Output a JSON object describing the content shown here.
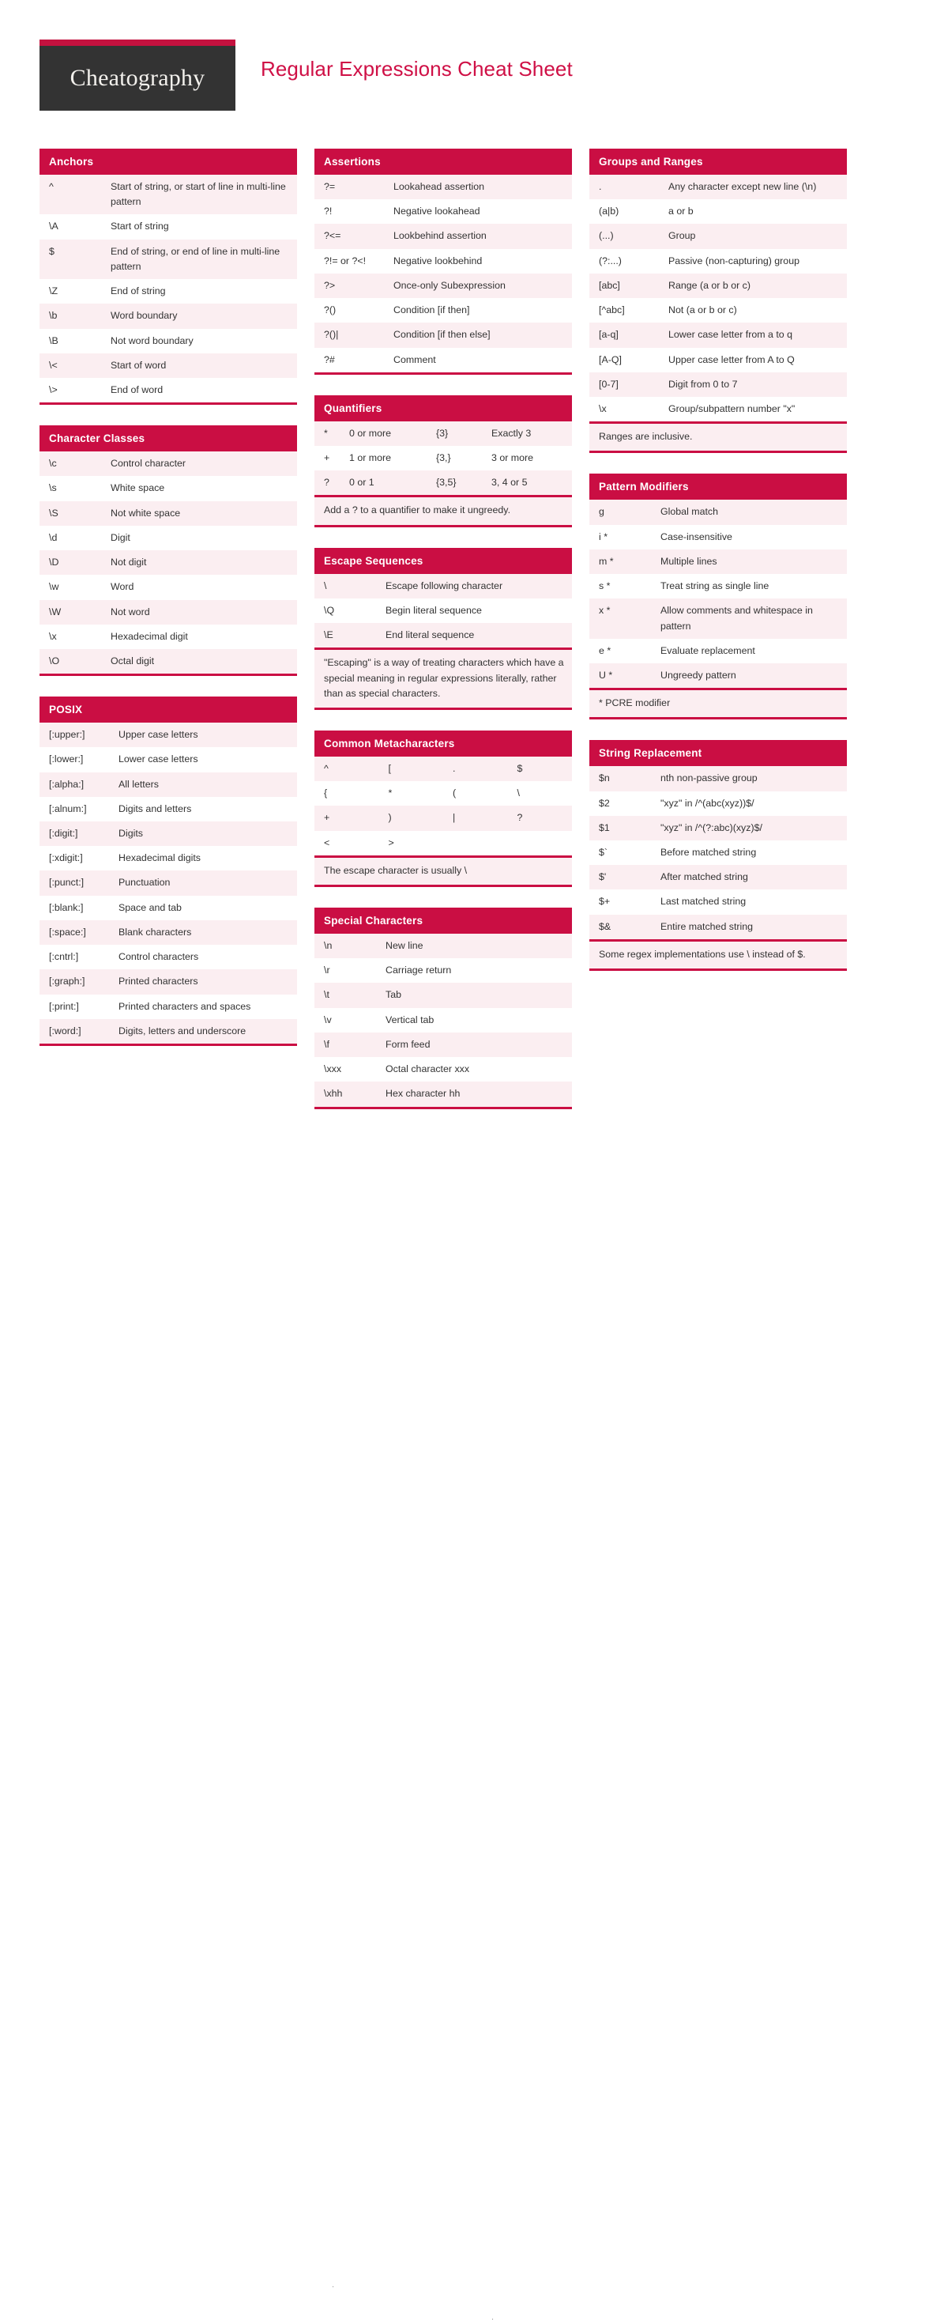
{
  "header": {
    "logo": "Cheatography",
    "title": "Regular Expressions Cheat Sheet"
  },
  "colors": {
    "brand": "#ca0e43",
    "title": "#cf1046",
    "row_alt": "#fbeef1",
    "logo_bg": "#333333"
  },
  "columns": [
    {
      "blocks": [
        {
          "title": "Anchors",
          "type": "pairs",
          "rows": [
            [
              "^",
              "Start of string, or start of line in multi-line pattern"
            ],
            [
              "\\A",
              "Start of string"
            ],
            [
              "$",
              "End of string, or end of line in multi-line pattern"
            ],
            [
              "\\Z",
              "End of string"
            ],
            [
              "\\b",
              "Word boundary"
            ],
            [
              "\\B",
              "Not word boundary"
            ],
            [
              "\\<",
              "Start of word"
            ],
            [
              "\\>",
              "End of word"
            ]
          ]
        },
        {
          "title": "Character Classes",
          "type": "pairs",
          "rows": [
            [
              "\\c",
              "Control character"
            ],
            [
              "\\s",
              "White space"
            ],
            [
              "\\S",
              "Not white space"
            ],
            [
              "\\d",
              "Digit"
            ],
            [
              "\\D",
              "Not digit"
            ],
            [
              "\\w",
              "Word"
            ],
            [
              "\\W",
              "Not word"
            ],
            [
              "\\x",
              "Hexadecimal digit"
            ],
            [
              "\\O",
              "Octal digit"
            ]
          ]
        },
        {
          "title": "POSIX",
          "type": "pairs",
          "rows": [
            [
              "[:upper:]",
              "Upper case letters"
            ],
            [
              "[:lower:]",
              "Lower case letters"
            ],
            [
              "[:alpha:]",
              "All letters"
            ],
            [
              "[:alnum:]",
              "Digits and letters"
            ],
            [
              "[:digit:]",
              "Digits"
            ],
            [
              "[:xdigit:]",
              "Hexadecimal digits"
            ],
            [
              "[:punct:]",
              "Punctuation"
            ],
            [
              "[:blank:]",
              "Space and tab"
            ],
            [
              "[:space:]",
              "Blank characters"
            ],
            [
              "[:cntrl:]",
              "Control characters"
            ],
            [
              "[:graph:]",
              "Printed characters"
            ],
            [
              "[:print:]",
              "Printed characters and spaces"
            ],
            [
              "[:word:]",
              "Digits, letters and underscore"
            ]
          ]
        }
      ]
    },
    {
      "blocks": [
        {
          "title": "Assertions",
          "type": "pairs",
          "rows": [
            [
              "?=",
              "Lookahead assertion"
            ],
            [
              "?!",
              "Negative lookahead"
            ],
            [
              "?<=",
              "Lookbehind assertion"
            ],
            [
              "?!= or ?<!",
              "Negative lookbehind"
            ],
            [
              "?>",
              "Once-only Subexpression"
            ],
            [
              "?()",
              "Condition [if then]"
            ],
            [
              "?()|",
              "Condition [if then else]"
            ],
            [
              "?#",
              "Comment"
            ]
          ]
        },
        {
          "title": "Quantifiers",
          "type": "quad",
          "rows": [
            [
              "*",
              "0 or more",
              "{3}",
              "Exactly 3"
            ],
            [
              "+",
              "1 or more",
              "{3,}",
              "3 or more"
            ],
            [
              "?",
              "0 or 1",
              "{3,5}",
              "3, 4 or 5"
            ]
          ],
          "footer": "Add a ? to a quantifier to make it ungreedy."
        },
        {
          "title": "Escape Sequences",
          "type": "pairs",
          "rows": [
            [
              "\\",
              "Escape following character"
            ],
            [
              "\\Q",
              "Begin literal sequence"
            ],
            [
              "\\E",
              "End literal sequence"
            ]
          ],
          "footer": "\"Escaping\" is a way of treating characters which have a special meaning in regular expressions literally, rather than as special characters."
        },
        {
          "title": "Common Metacharacters",
          "type": "meta",
          "rows": [
            [
              "^",
              "[",
              ".",
              "$"
            ],
            [
              "{",
              "*",
              "(",
              "\\"
            ],
            [
              "+",
              ")",
              "|",
              "?"
            ],
            [
              "<",
              ">",
              "",
              ""
            ]
          ],
          "footer": "The escape character is usually \\"
        },
        {
          "title": "Special Characters",
          "type": "pairs",
          "rows": [
            [
              "\\n",
              "New line"
            ],
            [
              "\\r",
              "Carriage return"
            ],
            [
              "\\t",
              "Tab"
            ],
            [
              "\\v",
              "Vertical tab"
            ],
            [
              "\\f",
              "Form feed"
            ],
            [
              "\\xxx",
              "Octal character xxx"
            ],
            [
              "\\xhh",
              "Hex character hh"
            ]
          ]
        }
      ]
    },
    {
      "blocks": [
        {
          "title": "Groups and Ranges",
          "type": "pairs",
          "rows": [
            [
              ".",
              "Any character except new line (\\n)"
            ],
            [
              "(a|b)",
              "a or b"
            ],
            [
              "(...)",
              "Group"
            ],
            [
              "(?:...)",
              "Passive (non-capturing) group"
            ],
            [
              "[abc]",
              "Range (a or b or c)"
            ],
            [
              "[^abc]",
              "Not (a or b or c)"
            ],
            [
              "[a-q]",
              "Lower case letter from a to q"
            ],
            [
              "[A-Q]",
              "Upper case letter from A to Q"
            ],
            [
              "[0-7]",
              "Digit from 0 to 7"
            ],
            [
              "\\x",
              "Group/subpattern number \"x\""
            ]
          ],
          "footer": "Ranges are inclusive."
        },
        {
          "title": "Pattern Modifiers",
          "type": "pairs",
          "rows": [
            [
              "g",
              "Global match"
            ],
            [
              "i *",
              "Case-insensitive"
            ],
            [
              "m *",
              "Multiple lines"
            ],
            [
              "s *",
              "Treat string as single line"
            ],
            [
              "x *",
              "Allow comments and whitespace in pattern"
            ],
            [
              "e *",
              "Evaluate replacement"
            ],
            [
              "U *",
              "Ungreedy pattern"
            ]
          ],
          "footer": "* PCRE modifier"
        },
        {
          "title": "String Replacement",
          "type": "pairs",
          "rows": [
            [
              "$n",
              "nth non-passive group"
            ],
            [
              "$2",
              "\"xyz\" in /^(abc(xyz))$/"
            ],
            [
              "$1",
              "\"xyz\" in /^(?:abc)(xyz)$/"
            ],
            [
              "$`",
              "Before matched string"
            ],
            [
              "$'",
              "After matched string"
            ],
            [
              "$+",
              "Last matched string"
            ],
            [
              "$&",
              "Entire matched string"
            ]
          ],
          "footer": "Some regex implementations use \\ instead of $."
        }
      ]
    }
  ]
}
